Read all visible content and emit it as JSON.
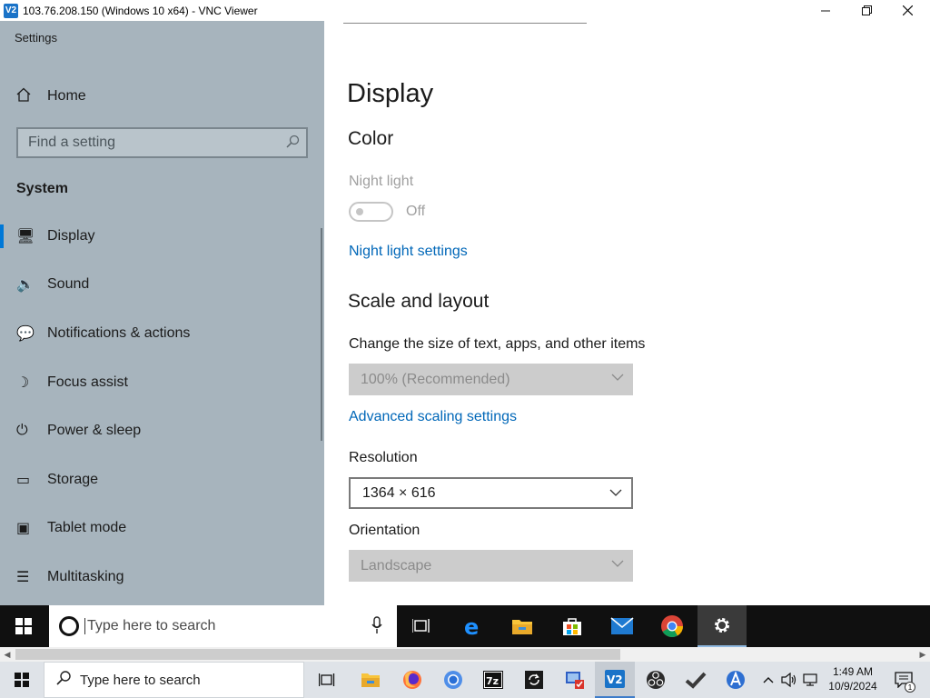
{
  "vnc": {
    "title": "103.76.208.150 (Windows 10 x64) - VNC Viewer",
    "logo": "V2"
  },
  "settings": {
    "app_title": "Settings",
    "home_label": "Home",
    "search_placeholder": "Find a setting",
    "section_label": "System",
    "nav": [
      {
        "label": "Display",
        "icon": "monitor-icon",
        "glyph": "🖥",
        "active": true
      },
      {
        "label": "Sound",
        "icon": "speaker-icon",
        "glyph": "🔉"
      },
      {
        "label": "Notifications & actions",
        "icon": "notification-icon",
        "glyph": "💬"
      },
      {
        "label": "Focus assist",
        "icon": "moon-icon",
        "glyph": "☽"
      },
      {
        "label": "Power & sleep",
        "icon": "power-icon",
        "glyph": "⏻"
      },
      {
        "label": "Storage",
        "icon": "storage-icon",
        "glyph": "▭"
      },
      {
        "label": "Tablet mode",
        "icon": "tablet-mode-icon",
        "glyph": "▣"
      },
      {
        "label": "Multitasking",
        "icon": "multitasking-icon",
        "glyph": "☰"
      }
    ]
  },
  "display": {
    "title": "Display",
    "color_heading": "Color",
    "night_light_label": "Night light",
    "night_light_state": "Off",
    "night_light_link": "Night light settings",
    "scale_heading": "Scale and layout",
    "scale_label": "Change the size of text, apps, and other items",
    "scale_value": "100% (Recommended)",
    "advanced_scaling_link": "Advanced scaling settings",
    "resolution_label": "Resolution",
    "resolution_value": "1364 × 616",
    "orientation_label": "Orientation",
    "orientation_value": "Landscape"
  },
  "remote_taskbar": {
    "search_placeholder": "Type here to search",
    "icons": [
      "task-view-icon",
      "edge-icon",
      "file-explorer-icon",
      "store-icon",
      "mail-icon",
      "chrome-icon",
      "settings-icon"
    ]
  },
  "host_taskbar": {
    "search_placeholder": "Type here to search",
    "time": "1:49 AM",
    "date": "10/9/2024",
    "notification_count": "1",
    "icons": [
      "task-view-icon",
      "file-explorer-icon",
      "firefox-icon",
      "chromium-icon",
      "7zip-icon",
      "sync-icon",
      "network-tool-icon",
      "vnc-viewer-icon",
      "obs-icon",
      "checkmark-icon",
      "app-icon"
    ]
  },
  "colors": {
    "accent": "#0078d7",
    "link": "#0067b8",
    "sidebar_bg": "#a7b4bd"
  }
}
